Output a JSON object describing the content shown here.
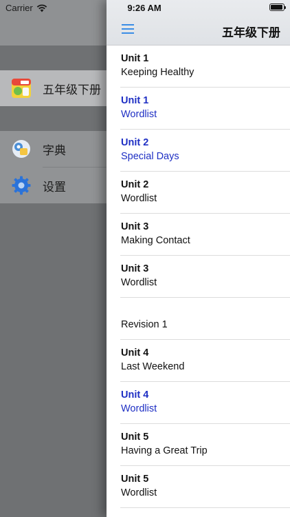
{
  "status": {
    "carrier": "Carrier",
    "time": "9:26 AM"
  },
  "drawer": {
    "book_title": "五年级下册",
    "items": [
      {
        "label": "字典",
        "icon": "dictionary-icon"
      },
      {
        "label": "设置",
        "icon": "settings-gear-icon"
      }
    ]
  },
  "panel": {
    "title": "五年级下册",
    "rows": [
      {
        "unit": "Unit 1",
        "subtitle": "Keeping Healthy",
        "selected": false
      },
      {
        "unit": "Unit 1",
        "subtitle": "Wordlist",
        "selected": true
      },
      {
        "unit": "Unit 2",
        "subtitle": "Special Days",
        "selected": true
      },
      {
        "unit": "Unit 2",
        "subtitle": "Wordlist",
        "selected": false
      },
      {
        "unit": "Unit 3",
        "subtitle": "Making Contact",
        "selected": false
      },
      {
        "unit": "Unit 3",
        "subtitle": "Wordlist",
        "selected": false
      },
      {
        "unit": "",
        "subtitle": "Revision 1",
        "selected": false
      },
      {
        "unit": "Unit 4",
        "subtitle": "Last Weekend",
        "selected": false
      },
      {
        "unit": "Unit 4",
        "subtitle": "Wordlist",
        "selected": true
      },
      {
        "unit": "Unit 5",
        "subtitle": "Having a Great Trip",
        "selected": false
      },
      {
        "unit": "Unit 5",
        "subtitle": "Wordlist",
        "selected": false
      }
    ]
  },
  "colors": {
    "selected_text": "#1e2fc4",
    "menu_icon": "#3a8de6"
  }
}
